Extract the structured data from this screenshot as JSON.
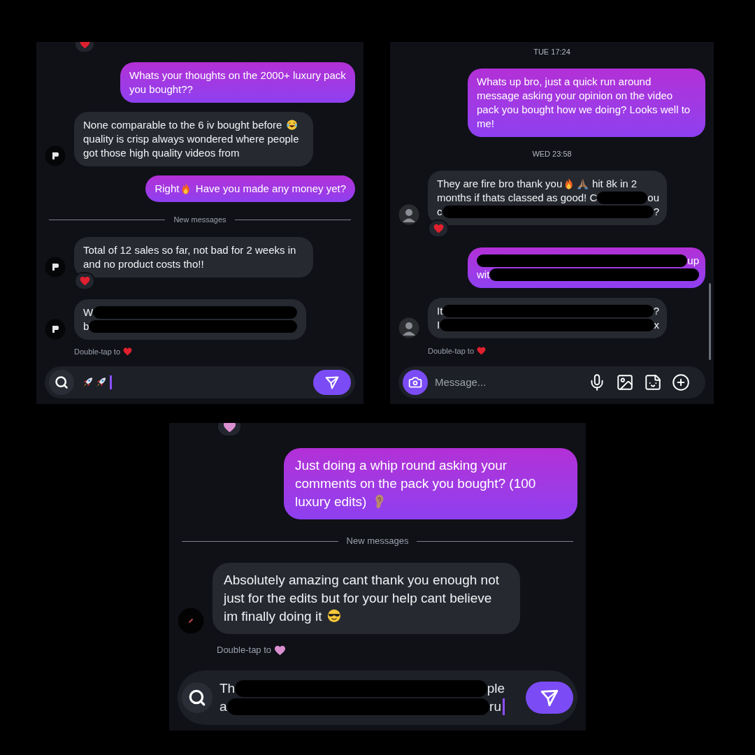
{
  "panels": [
    {
      "items": [
        {
          "kind": "reaction",
          "color": "#e0202e"
        },
        {
          "kind": "outgoing",
          "segments": [
            {
              "kind": "text",
              "text": "Whats your thoughts on the 2000+ luxury pack you bought??"
            }
          ]
        },
        {
          "kind": "incoming",
          "avatar": {
            "kind": "logo"
          },
          "segments": [
            {
              "kind": "text",
              "text": "None comparable to the 6 iv bought before "
            },
            {
              "kind": "laugh"
            },
            {
              "kind": "text",
              "text": " quality is crisp always wondered where people got those high quality videos from"
            }
          ]
        },
        {
          "kind": "outgoing",
          "segments": [
            {
              "kind": "text",
              "text": "Right"
            },
            {
              "kind": "fire"
            },
            {
              "kind": "text",
              "text": " Have you made any money yet?"
            }
          ]
        },
        {
          "kind": "divider",
          "text": "New messages"
        },
        {
          "kind": "incoming",
          "avatar": {
            "kind": "logo"
          },
          "segments": [
            {
              "kind": "text",
              "text": "Total of 12 sales so far, not bad for 2 weeks in and no product costs tho!!"
            }
          ],
          "reaction": {
            "color": "#e0202e"
          }
        },
        {
          "kind": "incoming",
          "avatar": {
            "kind": "logo"
          },
          "lines": [
            [
              {
                "kind": "text",
                "text": "W"
              },
              {
                "kind": "redaction"
              }
            ],
            [
              {
                "kind": "text",
                "text": "b"
              },
              {
                "kind": "redaction"
              }
            ]
          ]
        },
        {
          "kind": "hint",
          "text": "Double-tap to",
          "color": "#e0202e"
        }
      ],
      "composer": {
        "button": {
          "kind": "search"
        },
        "value_segments": [
          {
            "kind": "rocket"
          },
          {
            "kind": "rocket"
          }
        ],
        "focused": true,
        "send": true
      }
    },
    {
      "items": [
        {
          "kind": "timestamp",
          "text": "TUE 17:24"
        },
        {
          "kind": "outgoing",
          "segments": [
            {
              "kind": "text",
              "text": "Whats up bro, just a quick run around message asking your opinion on the video pack you bought how we doing? Looks well to me!"
            }
          ]
        },
        {
          "kind": "timestamp",
          "text": "WED 23:58"
        },
        {
          "kind": "incoming",
          "avatar": {
            "kind": "photo"
          },
          "lines": [
            [
              {
                "kind": "text",
                "text": "They are fire bro thank you"
              },
              {
                "kind": "fire"
              },
              {
                "kind": "pray"
              },
              {
                "kind": "text",
                "text": " hit 8k in 2"
              }
            ],
            [
              {
                "kind": "text",
                "text": "months if thats classed as good! C"
              },
              {
                "kind": "redaction"
              },
              {
                "kind": "text",
                "text": "ou"
              }
            ],
            [
              {
                "kind": "text",
                "text": "c"
              },
              {
                "kind": "redaction"
              },
              {
                "kind": "text",
                "text": "?"
              }
            ]
          ],
          "reaction": {
            "color": "#e0202e"
          }
        },
        {
          "kind": "outgoing",
          "lines": [
            [
              {
                "kind": "redaction"
              },
              {
                "kind": "text",
                "text": "up"
              }
            ],
            [
              {
                "kind": "text",
                "text": "wit"
              },
              {
                "kind": "redaction"
              }
            ]
          ]
        },
        {
          "kind": "incoming",
          "avatar": {
            "kind": "photo"
          },
          "lines": [
            [
              {
                "kind": "text",
                "text": "It"
              },
              {
                "kind": "redaction"
              },
              {
                "kind": "text",
                "text": "?"
              }
            ],
            [
              {
                "kind": "text",
                "text": "I"
              },
              {
                "kind": "redaction"
              },
              {
                "kind": "text",
                "text": "x"
              }
            ]
          ]
        },
        {
          "kind": "hint",
          "text": "Double-tap to",
          "color": "#e0202e"
        }
      ],
      "scrollbar": true,
      "composer": {
        "button": {
          "kind": "camera"
        },
        "placeholder": "Message...",
        "focused": false,
        "send": false,
        "actions": [
          {
            "kind": "mic"
          },
          {
            "kind": "image"
          },
          {
            "kind": "sticker"
          },
          {
            "kind": "plus"
          }
        ]
      }
    },
    {
      "items": [
        {
          "kind": "reaction",
          "color": "#d98fd0"
        },
        {
          "kind": "outgoing",
          "segments": [
            {
              "kind": "text",
              "text": "Just doing a whip round asking your comments on the pack you bought? (100 luxury edits) "
            },
            {
              "kind": "ear"
            }
          ]
        },
        {
          "kind": "divider",
          "text": "New messages"
        },
        {
          "kind": "incoming",
          "avatar": {
            "kind": "dot"
          },
          "segments": [
            {
              "kind": "text",
              "text": "Absolutely amazing cant thank you enough not just for the edits but for your help cant believe im finally doing it "
            },
            {
              "kind": "cool"
            }
          ]
        },
        {
          "kind": "hint",
          "text": "Double-tap to",
          "color": "#d98fd0"
        }
      ],
      "composer": {
        "button": {
          "kind": "search"
        },
        "value_lines": [
          [
            {
              "kind": "text",
              "text": "Th"
            },
            {
              "kind": "redaction"
            },
            {
              "kind": "text",
              "text": "ple"
            }
          ],
          [
            {
              "kind": "text",
              "text": "a"
            },
            {
              "kind": "redaction"
            },
            {
              "kind": "text",
              "text": "ru"
            }
          ]
        ],
        "focused": true,
        "send": true
      }
    }
  ]
}
